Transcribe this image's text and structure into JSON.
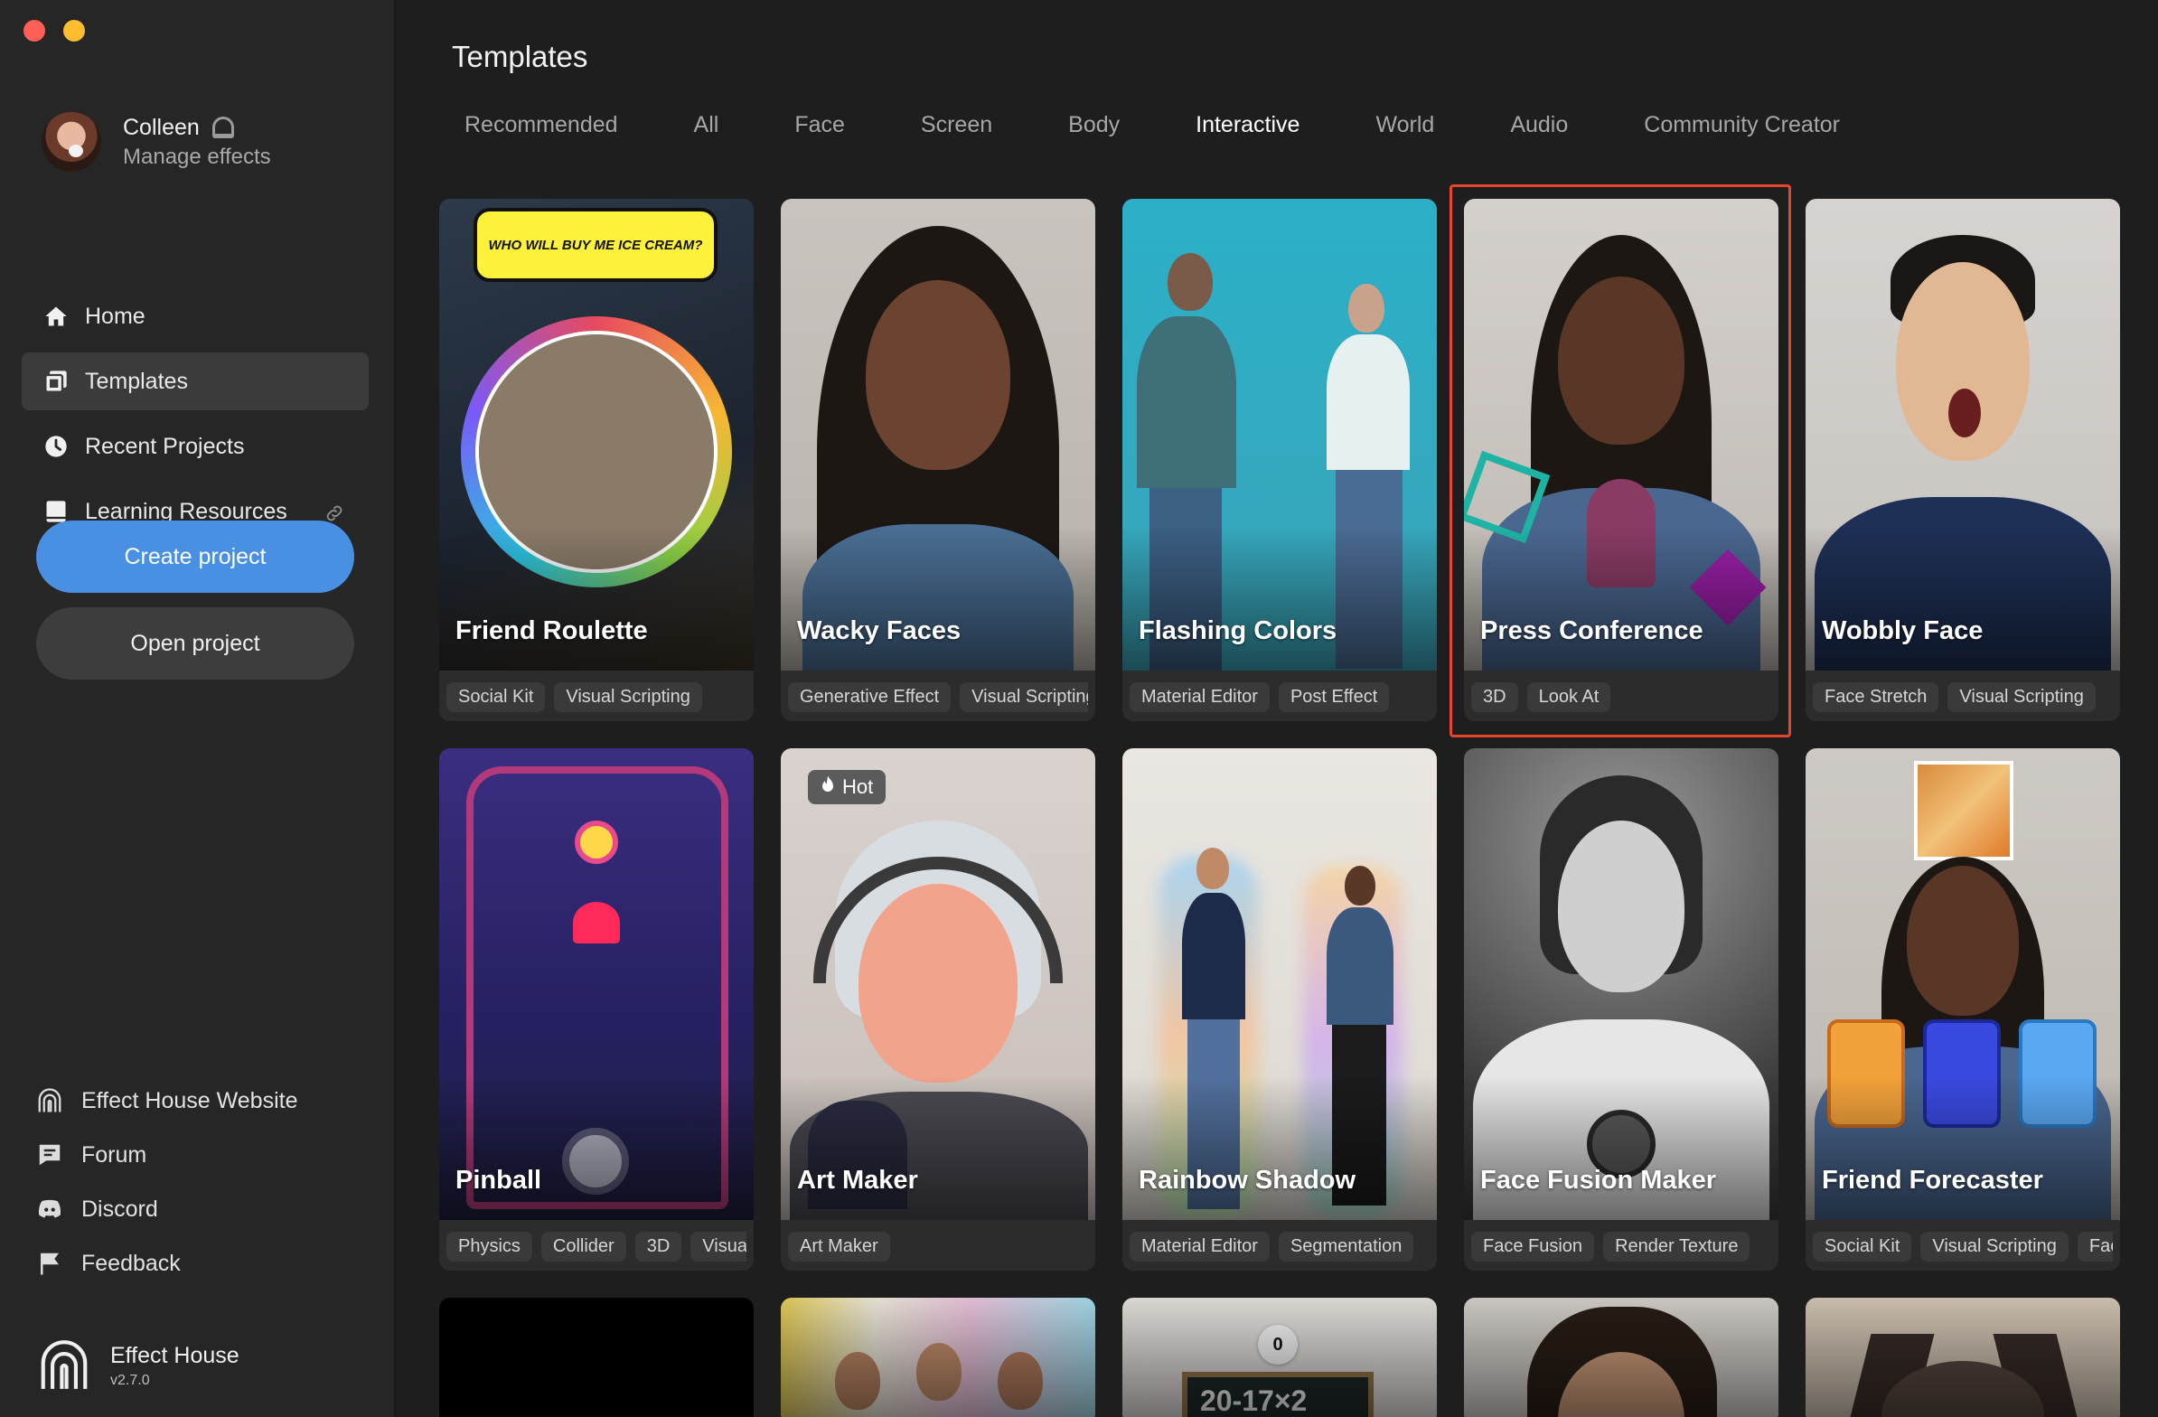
{
  "sidebar": {
    "user_name": "Colleen",
    "user_sub": "Manage effects",
    "nav": [
      {
        "label": "Home",
        "icon": "home-icon"
      },
      {
        "label": "Templates",
        "icon": "templates-icon"
      },
      {
        "label": "Recent Projects",
        "icon": "clock-icon"
      },
      {
        "label": "Learning Resources",
        "icon": "book-icon"
      }
    ],
    "create_project": "Create project",
    "open_project": "Open project",
    "links": [
      {
        "label": "Effect House Website",
        "icon": "effect-house-icon"
      },
      {
        "label": "Forum",
        "icon": "forum-icon"
      },
      {
        "label": "Discord",
        "icon": "discord-icon"
      },
      {
        "label": "Feedback",
        "icon": "flag-icon"
      }
    ],
    "brand_name": "Effect House",
    "brand_version": "v2.7.0"
  },
  "main": {
    "title": "Templates",
    "tabs": [
      "Recommended",
      "All",
      "Face",
      "Screen",
      "Body",
      "Interactive",
      "World",
      "Audio",
      "Community Creator"
    ],
    "active_tab": "Interactive",
    "cards": [
      {
        "title": "Friend Roulette",
        "tags": [
          "Social Kit",
          "Visual Scripting"
        ],
        "bubble": "WHO WILL BUY ME ICE CREAM?"
      },
      {
        "title": "Wacky Faces",
        "tags": [
          "Generative Effect",
          "Visual Scripting"
        ]
      },
      {
        "title": "Flashing Colors",
        "tags": [
          "Material Editor",
          "Post Effect"
        ]
      },
      {
        "title": "Press Conference",
        "tags": [
          "3D",
          "Look At"
        ],
        "selected": true
      },
      {
        "title": "Wobbly Face",
        "tags": [
          "Face Stretch",
          "Visual Scripting"
        ]
      },
      {
        "title": "Pinball",
        "tags": [
          "Physics",
          "Collider",
          "3D",
          "Visual Scripting"
        ]
      },
      {
        "title": "Art Maker",
        "tags": [
          "Art Maker"
        ],
        "badge": "Hot"
      },
      {
        "title": "Rainbow Shadow",
        "tags": [
          "Material Editor",
          "Segmentation"
        ]
      },
      {
        "title": "Face Fusion Maker",
        "tags": [
          "Face Fusion",
          "Render Texture"
        ]
      },
      {
        "title": "Friend Forecaster",
        "tags": [
          "Social Kit",
          "Visual Scripting",
          "Face"
        ]
      }
    ],
    "partial_row_text": {
      "counter": "0",
      "equation": "20-17×2"
    }
  },
  "colors": {
    "accent": "#4a90e2",
    "selection": "#e5442d"
  }
}
